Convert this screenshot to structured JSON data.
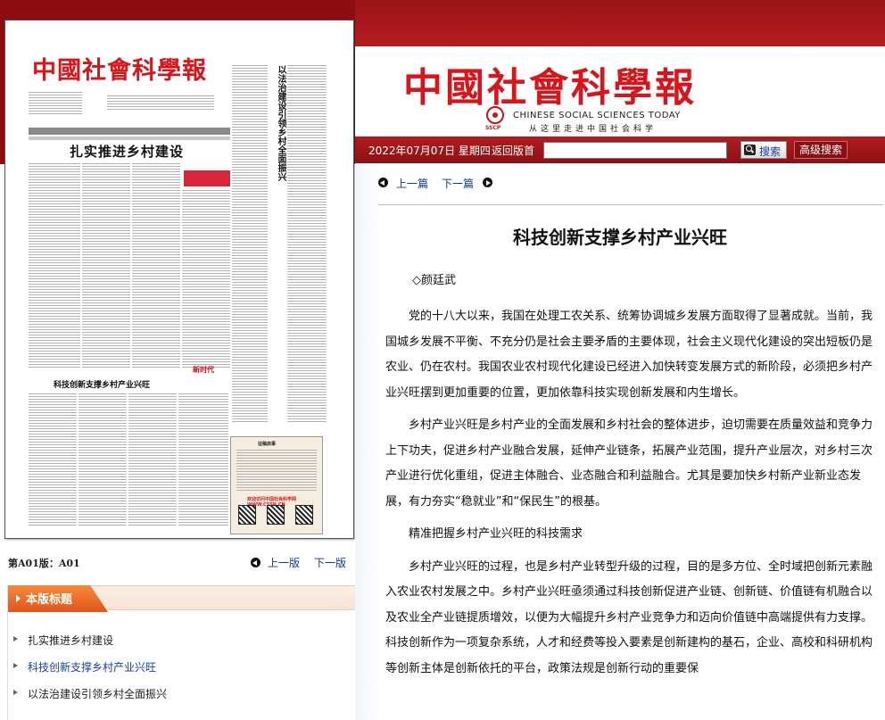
{
  "masthead": {
    "title": "中國社會科學報",
    "logo_small": "SSCP",
    "english": "CHINESE  SOCIAL  SCIENCES  TODAY",
    "slogan": "从这里走进中国社会科学"
  },
  "search_bar": {
    "date": "2022年07月07日 星期四",
    "back_label": "返回版首",
    "search_value": "",
    "search_label": "搜索",
    "advanced_label": "高级搜索"
  },
  "nav": {
    "prev_article": "上一篇",
    "next_article": "下一篇",
    "prev_edition": "上一版",
    "next_edition": "下一版"
  },
  "edition": {
    "label": "第A01版：A01"
  },
  "paper_thumbnail": {
    "headline_1": "扎实推进乡村建设",
    "headline_2": "科技创新支撑乡村产业兴旺",
    "vertical_headline": "以法治建设引领乡村全面振兴",
    "box_title": "征稿启事",
    "box_site": "欢迎访问中国社会科学网 WWW.CSSN.CN",
    "logo_text": "新时代"
  },
  "section": {
    "title": "本版标题",
    "items": [
      {
        "label": "扎实推进乡村建设",
        "active": false
      },
      {
        "label": "科技创新支撑乡村产业兴旺",
        "active": true
      },
      {
        "label": "以法治建设引领乡村全面振兴",
        "active": false
      }
    ]
  },
  "article": {
    "title": "科技创新支撑乡村产业兴旺",
    "author": "◇颜廷武",
    "paragraphs": [
      "党的十八大以来，我国在处理工农关系、统筹协调城乡发展方面取得了显著成就。当前，我国城乡发展不平衡、不充分仍是社会主要矛盾的主要体现，社会主义现代化建设的突出短板仍是农业、仍在农村。我国农业农村现代化建设已经进入加快转变发展方式的新阶段，必须把乡村产业兴旺摆到更加重要的位置，更加依靠科技实现创新发展和内生增长。",
      "乡村产业兴旺是乡村产业的全面发展和乡村社会的整体进步，迫切需要在质量效益和竞争力上下功夫，促进乡村产业融合发展，延伸产业链条，拓展产业范围，提升产业层次，对乡村三次产业进行优化重组，促进主体融合、业态融合和利益融合。尤其是要加快乡村新产业新业态发展，有力夯实“稳就业”和“保民生”的根基。",
      "精准把握乡村产业兴旺的科技需求",
      "乡村产业兴旺的过程，也是乡村产业转型升级的过程，目的是多方位、全时域把创新元素融入农业农村发展之中。乡村产业兴旺亟须通过科技创新促进产业链、创新链、价值链有机融合以及农业全产业链提质增效，以便为大幅提升乡村产业竞争力和迈向价值链中高端提供有力支撑。科技创新作为一项复杂系统，人才和经费等投入要素是创新建构的基石，企业、高校和科研机构等创新主体是创新依托的平台，政策法规是创新行动的重要保"
    ]
  }
}
